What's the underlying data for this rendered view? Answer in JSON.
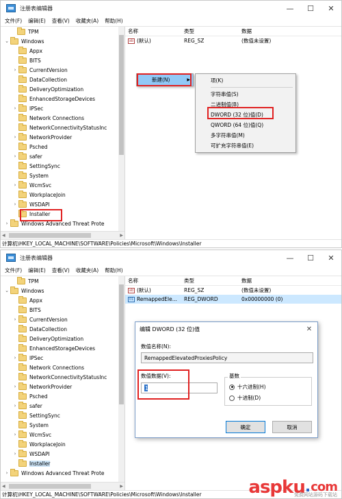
{
  "window1": {
    "title": "注册表编辑器",
    "menu": [
      "文件(F)",
      "编辑(E)",
      "查看(V)",
      "收藏夹(A)",
      "帮助(H)"
    ],
    "tree": [
      {
        "label": "TPM",
        "level": 1,
        "chevron": ""
      },
      {
        "label": "Windows",
        "level": 0,
        "chevron": "v"
      },
      {
        "label": "Appx",
        "level": 2,
        "chevron": ""
      },
      {
        "label": "BITS",
        "level": 2,
        "chevron": ""
      },
      {
        "label": "CurrentVersion",
        "level": 2,
        "chevron": ">"
      },
      {
        "label": "DataCollection",
        "level": 2,
        "chevron": ""
      },
      {
        "label": "DeliveryOptimization",
        "level": 2,
        "chevron": ""
      },
      {
        "label": "EnhancedStorageDevices",
        "level": 2,
        "chevron": ""
      },
      {
        "label": "IPSec",
        "level": 2,
        "chevron": ">"
      },
      {
        "label": "Network Connections",
        "level": 2,
        "chevron": ""
      },
      {
        "label": "NetworkConnectivityStatusInc",
        "level": 2,
        "chevron": ""
      },
      {
        "label": "NetworkProvider",
        "level": 2,
        "chevron": ">"
      },
      {
        "label": "Psched",
        "level": 2,
        "chevron": ""
      },
      {
        "label": "safer",
        "level": 2,
        "chevron": ">"
      },
      {
        "label": "SettingSync",
        "level": 2,
        "chevron": ""
      },
      {
        "label": "System",
        "level": 2,
        "chevron": ""
      },
      {
        "label": "WcmSvc",
        "level": 2,
        "chevron": ">"
      },
      {
        "label": "WorkplaceJoin",
        "level": 2,
        "chevron": ""
      },
      {
        "label": "WSDAPI",
        "level": 2,
        "chevron": ">"
      },
      {
        "label": "Installer",
        "level": 2,
        "chevron": ""
      },
      {
        "label": "Windows Advanced Threat Prote",
        "level": 0,
        "chevron": ">"
      }
    ],
    "columns": {
      "name": "名称",
      "type": "类型",
      "data": "数据"
    },
    "rows": [
      {
        "icon": "ab",
        "name": "(默认)",
        "type": "REG_SZ",
        "data": "(数值未设置)"
      }
    ],
    "context_new": "新建(N)",
    "submenu": [
      "项(K)",
      "字符串值(S)",
      "二进制值(B)",
      "DWORD (32 位)值(D)",
      "QWORD (64 位)值(Q)",
      "多字符串值(M)",
      "可扩充字符串值(E)"
    ],
    "status": "计算机\\HKEY_LOCAL_MACHINE\\SOFTWARE\\Policies\\Microsoft\\Windows\\Installer"
  },
  "window2": {
    "title": "注册表编辑器",
    "menu": [
      "文件(F)",
      "编辑(E)",
      "查看(V)",
      "收藏夹(A)",
      "帮助(H)"
    ],
    "tree": [
      {
        "label": "TPM",
        "level": 1,
        "chevron": ""
      },
      {
        "label": "Windows",
        "level": 0,
        "chevron": "v"
      },
      {
        "label": "Appx",
        "level": 2,
        "chevron": ""
      },
      {
        "label": "BITS",
        "level": 2,
        "chevron": ""
      },
      {
        "label": "CurrentVersion",
        "level": 2,
        "chevron": ">"
      },
      {
        "label": "DataCollection",
        "level": 2,
        "chevron": ""
      },
      {
        "label": "DeliveryOptimization",
        "level": 2,
        "chevron": ""
      },
      {
        "label": "EnhancedStorageDevices",
        "level": 2,
        "chevron": ""
      },
      {
        "label": "IPSec",
        "level": 2,
        "chevron": ">"
      },
      {
        "label": "Network Connections",
        "level": 2,
        "chevron": ""
      },
      {
        "label": "NetworkConnectivityStatusInc",
        "level": 2,
        "chevron": ""
      },
      {
        "label": "NetworkProvider",
        "level": 2,
        "chevron": ">"
      },
      {
        "label": "Psched",
        "level": 2,
        "chevron": ""
      },
      {
        "label": "safer",
        "level": 2,
        "chevron": ">"
      },
      {
        "label": "SettingSync",
        "level": 2,
        "chevron": ""
      },
      {
        "label": "System",
        "level": 2,
        "chevron": ""
      },
      {
        "label": "WcmSvc",
        "level": 2,
        "chevron": ">"
      },
      {
        "label": "WorkplaceJoin",
        "level": 2,
        "chevron": ""
      },
      {
        "label": "WSDAPI",
        "level": 2,
        "chevron": ">"
      },
      {
        "label": "Installer",
        "level": 2,
        "chevron": ""
      },
      {
        "label": "Windows Advanced Threat Prote",
        "level": 0,
        "chevron": ">"
      }
    ],
    "columns": {
      "name": "名称",
      "type": "类型",
      "data": "数据"
    },
    "rows": [
      {
        "icon": "ab",
        "name": "(默认)",
        "type": "REG_SZ",
        "data": "(数值未设置)"
      },
      {
        "icon": "01",
        "name": "RemappedEle...",
        "type": "REG_DWORD",
        "data": "0x00000000 (0)"
      }
    ],
    "status": "计算机\\HKEY_LOCAL_MACHINE\\SOFTWARE\\Policies\\Microsoft\\Windows\\Installer",
    "dialog": {
      "title": "编辑 DWORD (32 位)值",
      "name_label": "数值名称(N):",
      "name_value": "RemappedElevatedProxiesPolicy",
      "data_label": "数值数据(V):",
      "data_value": "1",
      "radix_label": "基数",
      "hex_label": "十六进制(H)",
      "dec_label": "十进制(D)",
      "ok_label": "确定",
      "cancel_label": "取消"
    }
  },
  "watermark": {
    "main": "aspku",
    "tld": "com",
    "sub": "免费网站源码下载站"
  },
  "colors": {
    "highlight": "#cce8ff",
    "annotation": "#e02020",
    "menu_highlight": "#91c9f7"
  }
}
